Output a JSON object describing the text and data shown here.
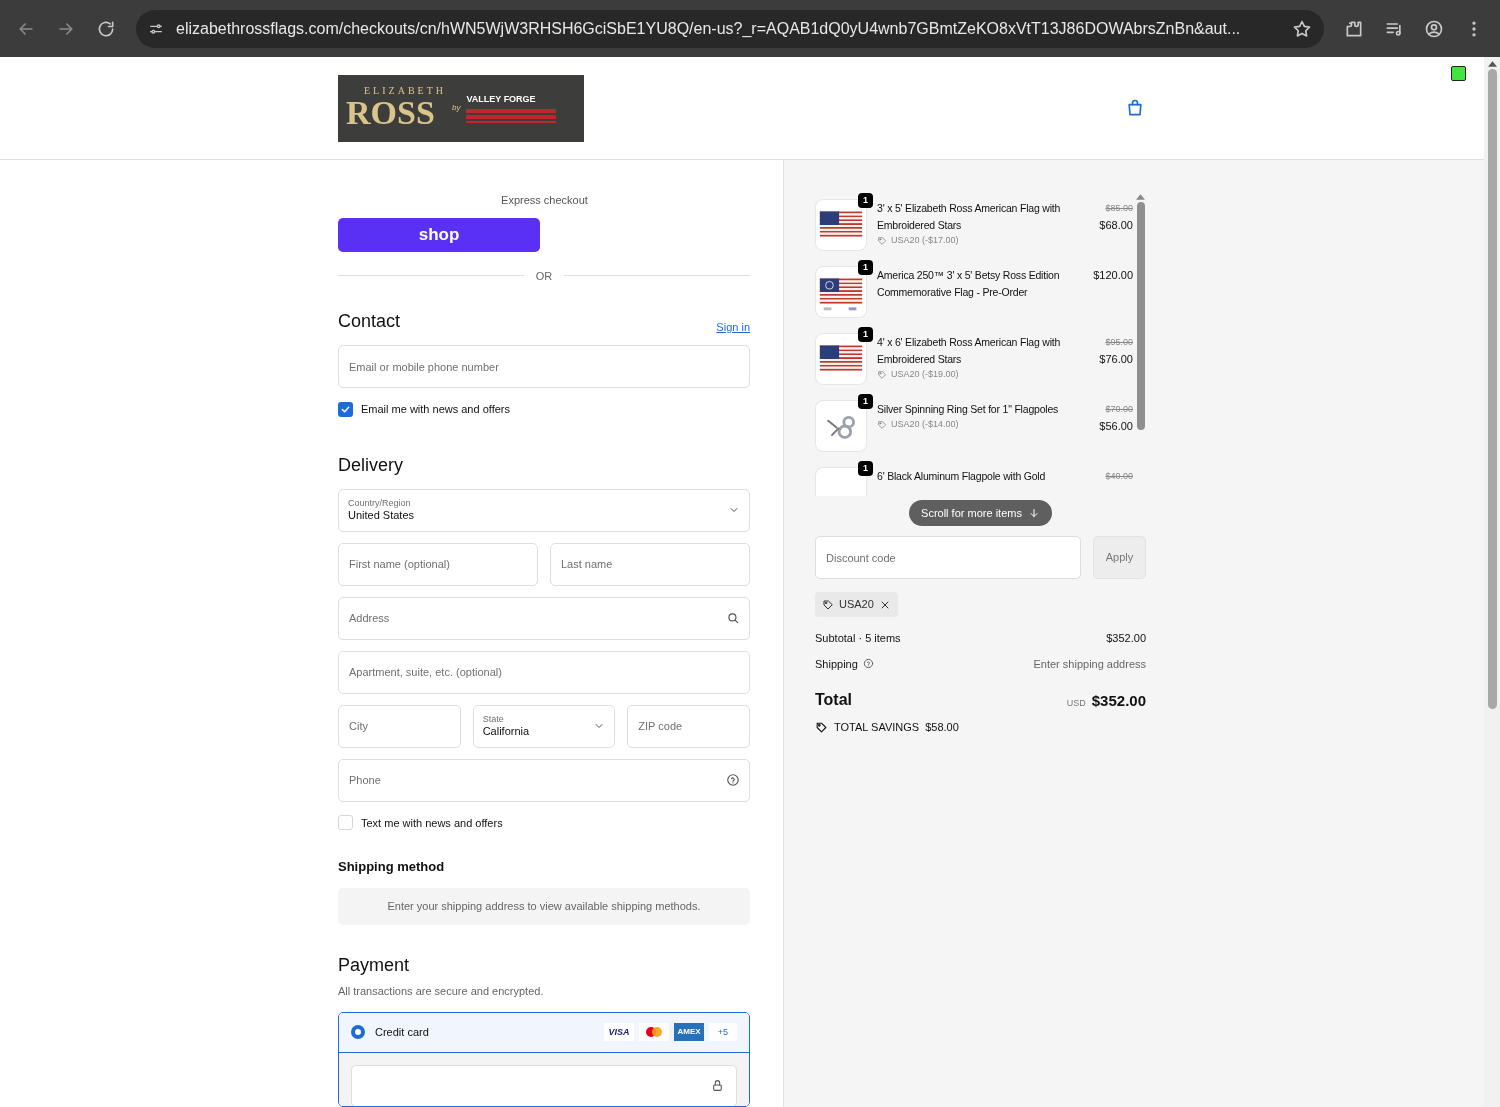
{
  "browser": {
    "url": "elizabethrossflags.com/checkouts/cn/hWN5WjW3RHSH6GciSbE1YU8Q/en-us?_r=AQAB1dQ0yU4wnb7GBmtZeKO8xVtT13J86DOWAbrsZnBn&aut..."
  },
  "logo": {
    "top": "ELIZABETH",
    "main": "ROSS",
    "by": "by",
    "brand": "VALLEY FORGE"
  },
  "express": {
    "label": "Express checkout",
    "button": "shop",
    "divider": "OR"
  },
  "contact": {
    "title": "Contact",
    "sign_in": "Sign in",
    "email_placeholder": "Email or mobile phone number",
    "newsletter": {
      "label": "Email me with news and offers",
      "checked": true
    }
  },
  "delivery": {
    "title": "Delivery",
    "country": {
      "label": "Country/Region",
      "value": "United States"
    },
    "first_name_placeholder": "First name (optional)",
    "last_name_placeholder": "Last name",
    "address_placeholder": "Address",
    "apartment_placeholder": "Apartment, suite, etc. (optional)",
    "city_placeholder": "City",
    "state": {
      "label": "State",
      "value": "California"
    },
    "zip_placeholder": "ZIP code",
    "phone_placeholder": "Phone",
    "sms": {
      "label": "Text me with news and offers",
      "checked": false
    }
  },
  "shipping_method": {
    "title": "Shipping method",
    "message": "Enter your shipping address to view available shipping methods."
  },
  "payment": {
    "title": "Payment",
    "subtitle": "All transactions are secure and encrypted.",
    "methods": [
      {
        "label": "Credit card",
        "selected": true,
        "cards": [
          {
            "kind": "visa",
            "text": "VISA"
          },
          {
            "kind": "mastercard"
          },
          {
            "kind": "amex",
            "text": "AMEX"
          },
          {
            "kind": "more",
            "text": "+5"
          }
        ]
      }
    ]
  },
  "summary": {
    "items": [
      {
        "kind": "flag",
        "qty": "1",
        "title": "3' x 5' Elizabeth Ross American Flag with Embroidered Stars",
        "discount": "USA20 (-$17.00)",
        "original": "$85.00",
        "price": "$68.00"
      },
      {
        "kind": "betsy-flag",
        "qty": "1",
        "title": "America 250™ 3' x 5' Betsy Ross Edition Commemorative Flag - Pre-Order",
        "price": "$120.00"
      },
      {
        "kind": "flag",
        "qty": "1",
        "title": "4' x 6' Elizabeth Ross American Flag with Embroidered Stars",
        "discount": "USA20 (-$19.00)",
        "original": "$95.00",
        "price": "$76.00"
      },
      {
        "kind": "rings",
        "qty": "1",
        "title": "Silver Spinning Ring Set for 1\" Flagpoles",
        "discount": "USA20 (-$14.00)",
        "original": "$70.00",
        "price": "$56.00"
      },
      {
        "kind": "pole",
        "qty": "1",
        "title": "6' Black Aluminum Flagpole with Gold",
        "original": "$40.00"
      }
    ],
    "scroll_hint": "Scroll for more items",
    "discount_placeholder": "Discount code",
    "apply": "Apply",
    "applied_code": "USA20",
    "subtotal_label": "Subtotal · 5 items",
    "subtotal": "$352.00",
    "shipping_label": "Shipping",
    "shipping": "Enter shipping address",
    "total_label": "Total",
    "currency": "USD",
    "total": "$352.00",
    "savings_label": "TOTAL SAVINGS",
    "savings": "$58.00"
  }
}
